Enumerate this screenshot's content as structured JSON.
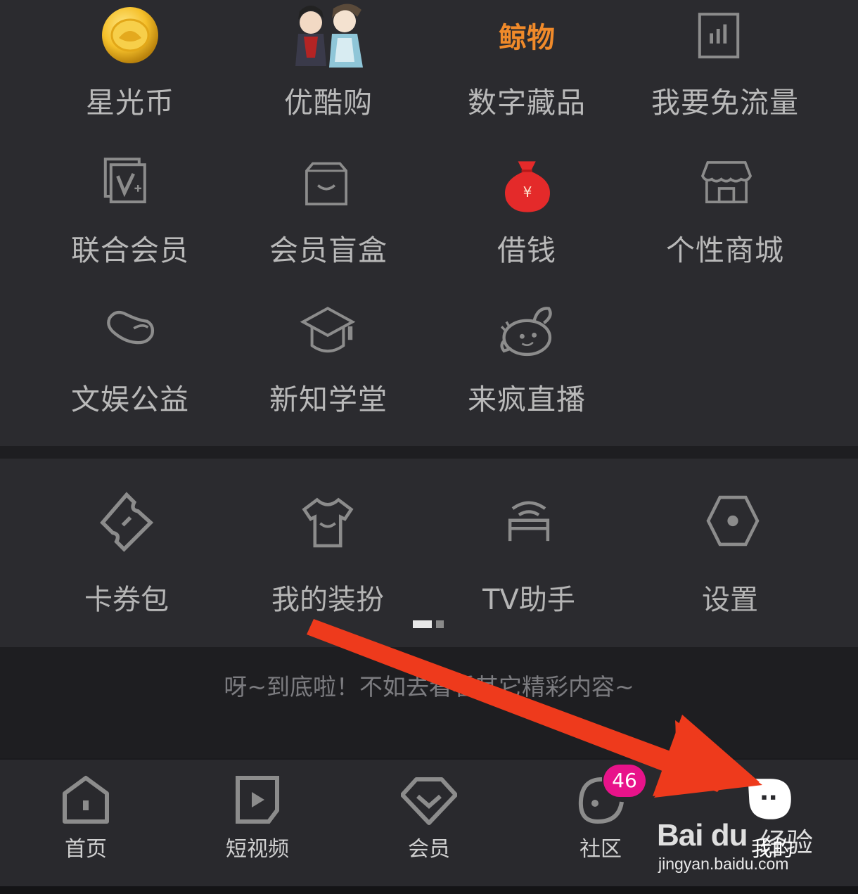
{
  "grid_top": [
    {
      "label": "星光币",
      "icon": "gold-coin-icon"
    },
    {
      "label": "优酷购",
      "icon": "cartoon-characters-icon",
      "icon_text": "",
      "img": true
    },
    {
      "label": "数字藏品",
      "icon": "digital-collectible-logo-icon",
      "icon_text": "鲸物"
    },
    {
      "label": "我要免流量",
      "icon": "data-bars-icon"
    },
    {
      "label": "联合会员",
      "icon": "joint-vip-icon"
    },
    {
      "label": "会员盲盒",
      "icon": "blind-box-icon"
    },
    {
      "label": "借钱",
      "icon": "money-bag-icon",
      "icon_text": "¥"
    },
    {
      "label": "个性商城",
      "icon": "store-icon"
    },
    {
      "label": "文娱公益",
      "icon": "heart-charity-icon"
    },
    {
      "label": "新知学堂",
      "icon": "graduation-cap-icon"
    },
    {
      "label": "来疯直播",
      "icon": "bee-mascot-icon"
    }
  ],
  "tools": [
    {
      "label": "卡券包",
      "icon": "ticket-icon"
    },
    {
      "label": "我的装扮",
      "icon": "tshirt-icon"
    },
    {
      "label": "TV助手",
      "icon": "tv-signal-icon"
    },
    {
      "label": "设置",
      "icon": "settings-hex-icon"
    }
  ],
  "end_message": "呀~到底啦！不如去看看其它精彩内容~",
  "bottom_nav": [
    {
      "label": "首页",
      "icon": "home-icon"
    },
    {
      "label": "短视频",
      "icon": "short-video-play-icon"
    },
    {
      "label": "会员",
      "icon": "vip-diamond-icon"
    },
    {
      "label": "社区",
      "icon": "community-icon",
      "badge": "46"
    },
    {
      "label": "我的",
      "icon": "profile-face-icon",
      "active": true
    }
  ],
  "watermark": {
    "logo": "Bai du",
    "cn": "经验",
    "url": "jingyan.baidu.com"
  },
  "colors": {
    "background": "#2b2b2f",
    "arrow": "#ee3a1c",
    "badge": "#e8138a",
    "icon": "#8c8c8c"
  }
}
